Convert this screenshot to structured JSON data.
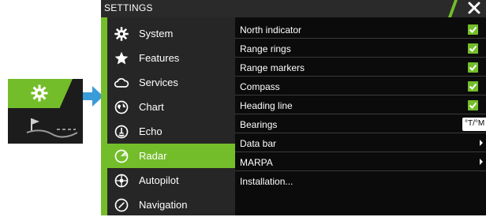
{
  "colors": {
    "accent": "#74bd2a",
    "window_bg": "#0b0b0b",
    "sidebar_bg": "#262626",
    "titlebar_bg": "#2a2a2a",
    "arrow_blue": "#3a9bd9"
  },
  "thumbnail": {
    "icons": [
      "gear-icon",
      "chart-icon"
    ]
  },
  "window": {
    "title": "SETTINGS",
    "close_icon": "close-icon"
  },
  "sidebar": {
    "items": [
      {
        "label": "System",
        "icon": "gear-icon"
      },
      {
        "label": "Features",
        "icon": "star-icon"
      },
      {
        "label": "Services",
        "icon": "cloud-icon"
      },
      {
        "label": "Chart",
        "icon": "globe-icon"
      },
      {
        "label": "Echo",
        "icon": "echo-icon"
      },
      {
        "label": "Radar",
        "icon": "radar-icon",
        "selected": true
      },
      {
        "label": "Autopilot",
        "icon": "autopilot-icon"
      },
      {
        "label": "Navigation",
        "icon": "compass-icon"
      }
    ]
  },
  "content": {
    "rows": [
      {
        "label": "North indicator",
        "control": "checkbox",
        "checked": true
      },
      {
        "label": "Range rings",
        "control": "checkbox",
        "checked": true
      },
      {
        "label": "Range markers",
        "control": "checkbox",
        "checked": true
      },
      {
        "label": "Compass",
        "control": "checkbox",
        "checked": true
      },
      {
        "label": "Heading line",
        "control": "checkbox",
        "checked": true
      },
      {
        "label": "Bearings",
        "control": "select",
        "value": "°T/°M -"
      },
      {
        "label": "Data bar",
        "control": "submenu"
      },
      {
        "label": "MARPA",
        "control": "submenu"
      },
      {
        "label": "Installation...",
        "control": "none"
      }
    ]
  }
}
